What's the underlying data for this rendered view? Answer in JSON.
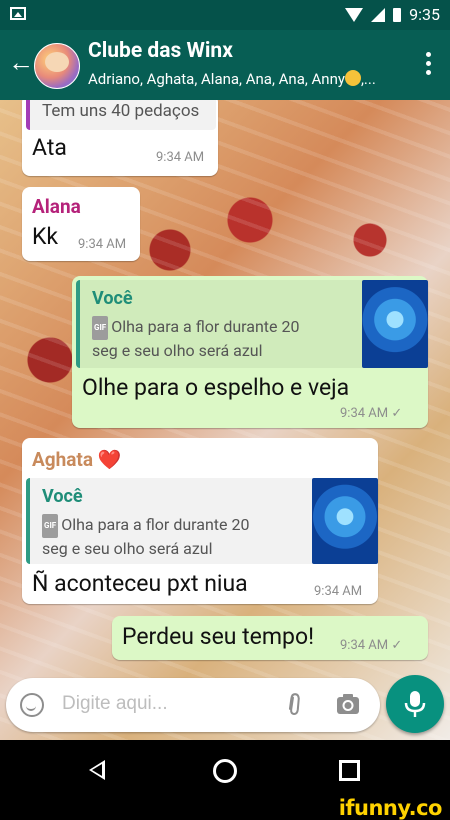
{
  "status_bar": {
    "time": "9:35"
  },
  "header": {
    "title": "Clube das Winx",
    "subtitle": "Adriano, Aghata, Alana, Ana, Ana, Anny",
    "subtitle_suffix": ",..."
  },
  "messages": [
    {
      "id": "m1",
      "type": "incoming",
      "quoted_text": "Tem uns 40 pedaços",
      "text": "Ata",
      "time": "9:34 AM"
    },
    {
      "id": "m2",
      "type": "incoming",
      "sender": "Alana",
      "text": "Kk",
      "time": "9:34 AM"
    },
    {
      "id": "m3",
      "type": "outgoing",
      "quoted_sender": "Você",
      "gif_tag": "GIF",
      "quoted_text_line1": "Olha para a flor durante 20",
      "quoted_text_line2": "seg e seu olho será azul",
      "text": "Olhe para o espelho e veja",
      "time": "9:34 AM",
      "ticks": "✓"
    },
    {
      "id": "m4",
      "type": "incoming",
      "sender": "Aghata",
      "sender_emoji": "❤️",
      "quoted_sender": "Você",
      "gif_tag": "GIF",
      "quoted_text_line1": "Olha para a flor durante 20",
      "quoted_text_line2": "seg e seu olho será azul",
      "text": "Ñ aconteceu pxt niua",
      "time": "9:34 AM"
    },
    {
      "id": "m5",
      "type": "outgoing",
      "text": "Perdeu seu tempo!",
      "time": "9:34 AM",
      "ticks": "✓"
    }
  ],
  "composer": {
    "placeholder": "Digite aqui..."
  },
  "watermark": "ifunny.co",
  "colors": {
    "header": "#075e54",
    "status_bar": "#05524a",
    "outgoing_bubble": "#dcf8c6",
    "incoming_bubble": "#ffffff",
    "accent": "#08917f",
    "alana_name": "#b5227a",
    "aghata_name": "#c88a5c"
  }
}
